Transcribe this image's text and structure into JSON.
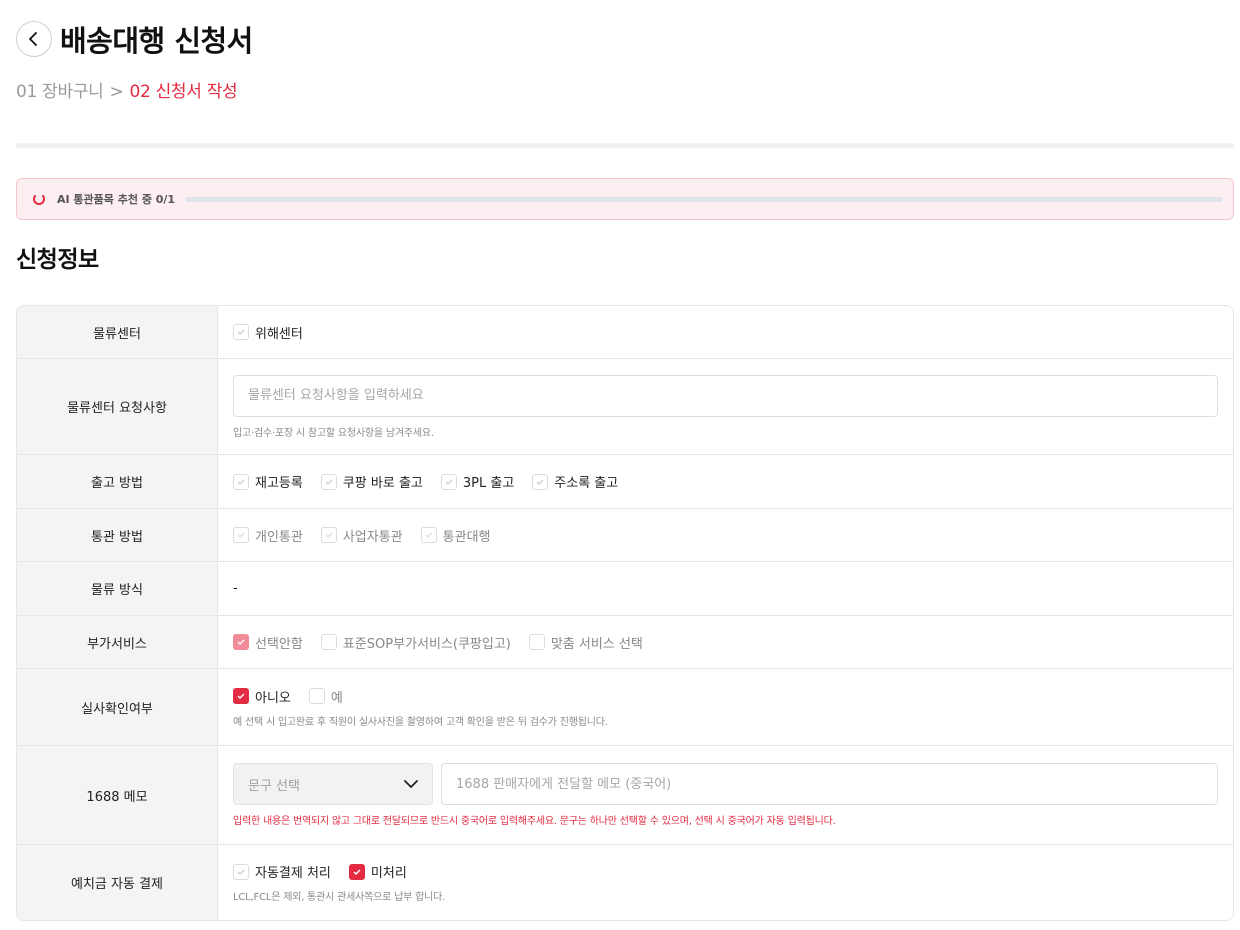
{
  "page": {
    "title": "배송대행 신청서",
    "breadcrumb": {
      "step1": "01 장바구니",
      "separator": ">",
      "step2": "02 신청서 작성"
    }
  },
  "ai": {
    "label": "AI 통관품목 추천 중 0/1",
    "progress": 0
  },
  "section": {
    "title": "신청정보"
  },
  "rows": {
    "center": {
      "label": "물류센터",
      "option": "위해센터"
    },
    "center_request": {
      "label": "물류센터 요청사항",
      "placeholder": "물류센터 요청사항을 입력하세요",
      "help": "입고·검수·포장 시 참고할 요청사항을 남겨주세요."
    },
    "shipping_method": {
      "label": "출고 방법",
      "options": [
        "재고등록",
        "쿠팡 바로 출고",
        "3PL 출고",
        "주소록 출고"
      ]
    },
    "customs_method": {
      "label": "통관 방법",
      "options": [
        "개인통관",
        "사업자통관",
        "통관대행"
      ]
    },
    "logistics": {
      "label": "물류 방식",
      "value": "-"
    },
    "extra_service": {
      "label": "부가서비스",
      "options": [
        "선택안함",
        "표준SOP부가서비스(쿠팡입고)",
        "맞춤 서비스 선택"
      ]
    },
    "photo_check": {
      "label": "실사확인여부",
      "options": [
        "아니오",
        "예"
      ],
      "help": "예 선택 시 입고완료 후 직원이 실사사진을 촬영하여 고객 확인을 받은 뒤 검수가 진행됩니다."
    },
    "memo1688": {
      "label": "1688 메모",
      "select_label": "문구 선택",
      "placeholder": "1688 판매자에게 전달할 메모 (중국어)",
      "help": "입력한 내용은 번역되지 않고 그대로 전달되므로 반드시 중국어로 입력해주세요. 문구는 하나만 선택할 수 있으며, 선택 시 중국어가 자동 입력됩니다."
    },
    "deposit": {
      "label": "예치금 자동 결제",
      "options": [
        "자동결제 처리",
        "미처리"
      ],
      "help": "LCL,FCL은 제외, 통관시 관세사쪽으로 납부 합니다."
    }
  },
  "colors": {
    "accent": "#e22a40"
  }
}
